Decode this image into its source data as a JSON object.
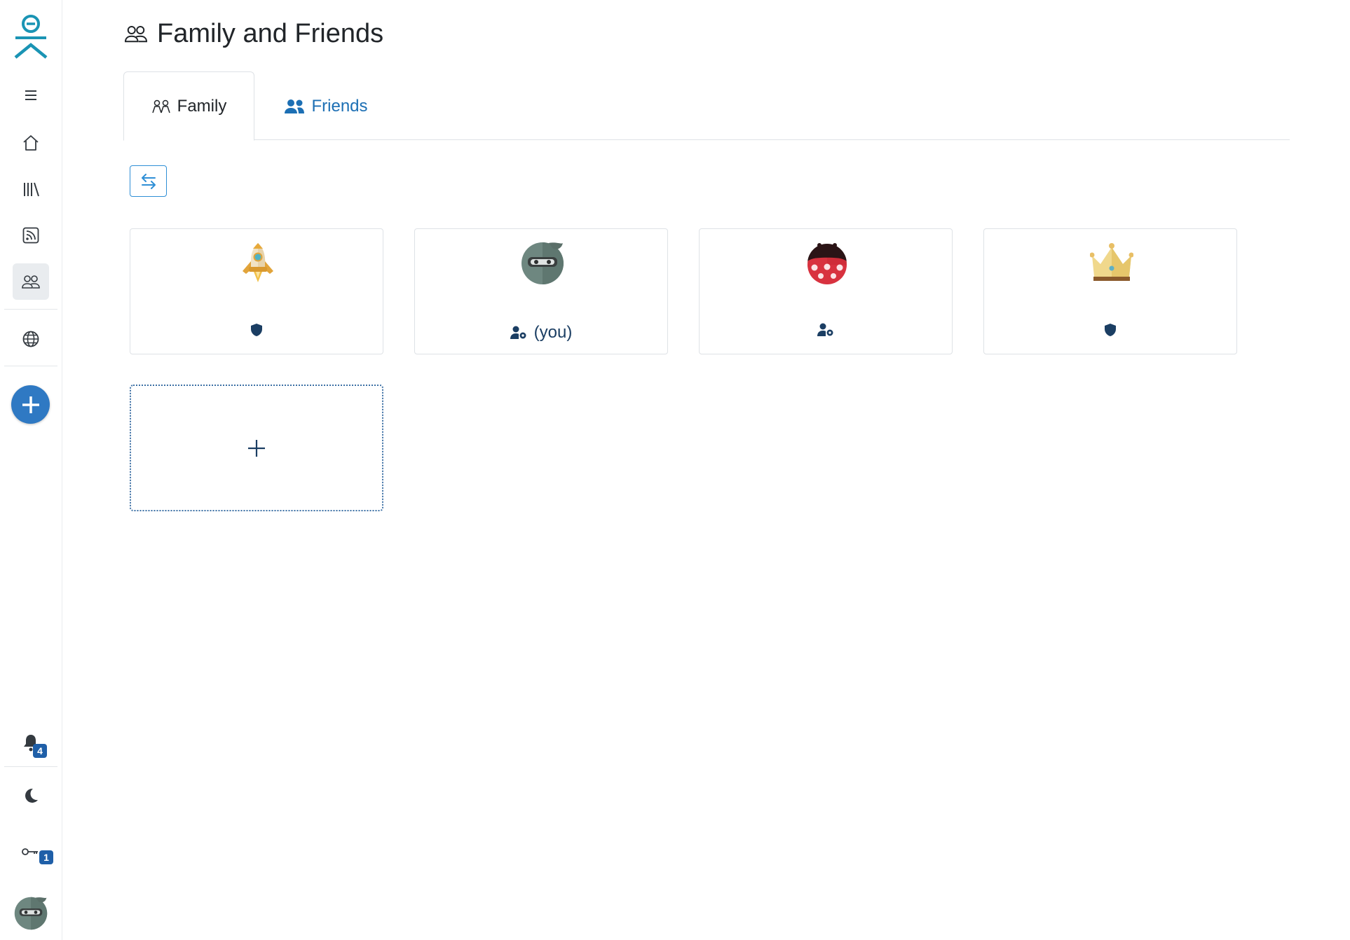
{
  "page": {
    "title": "Family and Friends"
  },
  "tabs": [
    {
      "label": "Family",
      "active": true,
      "icon": "family-icon"
    },
    {
      "label": "Friends",
      "active": false,
      "icon": "users-icon"
    }
  ],
  "toolbar": {
    "swap_icon": "arrows-swap-icon"
  },
  "members": [
    {
      "avatar": "rocket-avatar",
      "role_icon": "shield-icon",
      "suffix": ""
    },
    {
      "avatar": "ninja-avatar",
      "role_icon": "user-gear-icon",
      "suffix": "(you)"
    },
    {
      "avatar": "ladybug-avatar",
      "role_icon": "user-gear-icon",
      "suffix": ""
    },
    {
      "avatar": "crown-avatar",
      "role_icon": "shield-icon",
      "suffix": ""
    }
  ],
  "add_member": {
    "icon": "plus-icon"
  },
  "sidebar": {
    "badges": {
      "notifications": "4",
      "keys": "1"
    }
  },
  "colors": {
    "brand_teal": "#1a94b4",
    "link_blue": "#1c6fb4",
    "badge_blue": "#1f5fa8",
    "role_icon": "#1b3e63"
  }
}
